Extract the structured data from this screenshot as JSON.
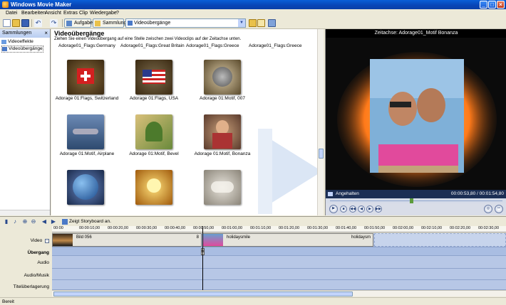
{
  "window": {
    "title": "Windows Movie Maker"
  },
  "menu": [
    "Datei",
    "Bearbeiten",
    "Ansicht",
    "Extras",
    "Clip",
    "Wiedergabe",
    "?"
  ],
  "toolbar": {
    "tasks_label": "Aufgaben",
    "collections_label": "Sammlungen",
    "combo_value": "Videoübergänge"
  },
  "collections": {
    "header": "Sammlungen",
    "items": [
      {
        "label": "Videoeffekte",
        "icon": "effects-icon"
      },
      {
        "label": "Videoübergänge",
        "icon": "transitions-icon",
        "selected": true
      }
    ]
  },
  "content": {
    "title": "Videoübergänge",
    "description": "Ziehen Sie einen Videoübergang auf eine Stelle zwischen zwei Videoclips auf der Zeitachse unten.",
    "header_labels": [
      "Adorage01_Flags:Germany",
      "Adorage01_Flags:Great Britain",
      "Adorage01_Flags:Greece",
      "Adorage01_Flags:Greece"
    ],
    "tiles": [
      {
        "label": "Adorage 01:Flags, Switzerland",
        "icon": "flag-switzerland-icon"
      },
      {
        "label": "Adorage 01:Flags, USA",
        "icon": "flag-usa-icon"
      },
      {
        "label": "Adorage 01:Motif, 007",
        "icon": "motif-007-icon"
      },
      {
        "label": "Adorage 01:Motif, Airplane",
        "icon": "motif-airplane-icon"
      },
      {
        "label": "Adorage 01:Motif, Bevel",
        "icon": "motif-bevel-icon"
      },
      {
        "label": "Adorage 01:Motif, Bonanza",
        "icon": "motif-bonanza-icon"
      },
      {
        "label": "",
        "icon": "motif-earth-icon"
      },
      {
        "label": "",
        "icon": "motif-sun-icon"
      },
      {
        "label": "",
        "icon": "motif-fog-icon"
      }
    ]
  },
  "preview": {
    "title": "Zeitachse: Adorage01_Motif Bonanza",
    "status": "Angehalten",
    "time": "00:00:53,80 / 00:01:54,80"
  },
  "timeline": {
    "storyboard_label": "Zeigt Storyboard an.",
    "track_labels": [
      "Video",
      "Übergang",
      "Audio",
      "Audio/Musik",
      "Titelüberlagerung"
    ],
    "ruler_ticks": [
      "00:00",
      "00:00:10,00",
      "00:00:20,00",
      "00:00:30,00",
      "00:00:40,00",
      "00:00:50,00",
      "00:01:00,00",
      "00:01:10,00",
      "00:01:20,00",
      "00:01:30,00",
      "00:01:40,00",
      "00:01:50,00",
      "00:02:00,00",
      "00:02:10,00",
      "00:02:20,00",
      "00:02:30,00"
    ],
    "clips": [
      {
        "label": "Bild 056",
        "end_label": "8"
      },
      {
        "label": "holidaysmile",
        "end_label": "holidaysm"
      }
    ],
    "transition_marker": "B"
  },
  "statusbar": {
    "text": "Bereit"
  }
}
